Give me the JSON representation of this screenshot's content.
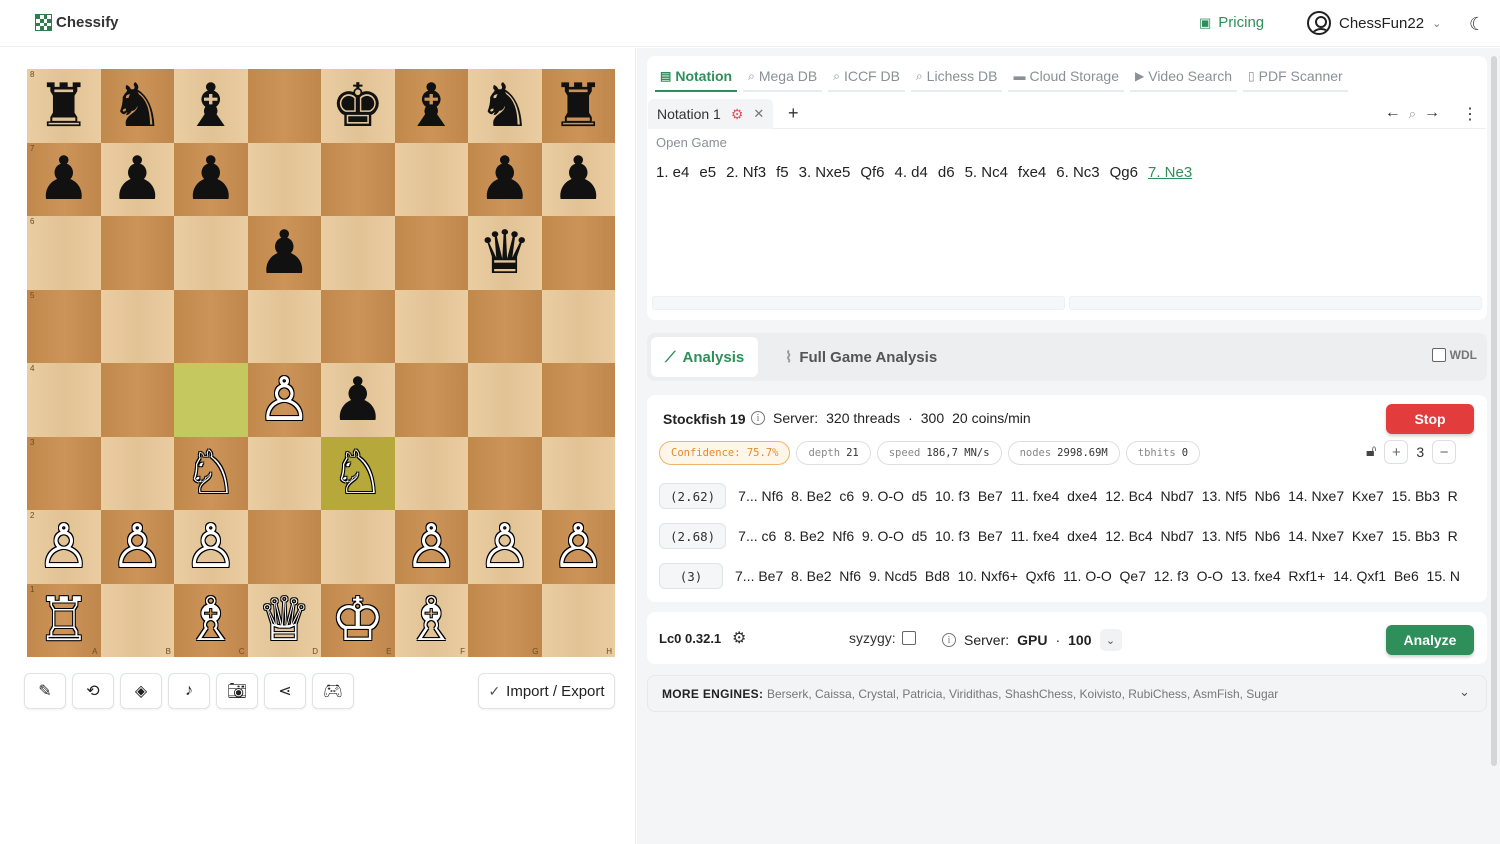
{
  "header": {
    "logo_text": "Chessify",
    "pricing_label": "Pricing",
    "username": "ChessFun22"
  },
  "board": {
    "ranks": [
      [
        "♜",
        "♞",
        "♝",
        "",
        "♚",
        "♝",
        "♞",
        "♜"
      ],
      [
        "♟",
        "♟",
        "♟",
        "",
        "",
        "",
        "♟",
        "♟"
      ],
      [
        "",
        "",
        "",
        "♟",
        "",
        "",
        "♛",
        ""
      ],
      [
        "",
        "",
        "",
        "",
        "",
        "",
        "",
        ""
      ],
      [
        "",
        "",
        "",
        "♙",
        "♟",
        "",
        "",
        ""
      ],
      [
        "",
        "",
        "♘",
        "",
        "♘",
        "",
        "",
        ""
      ],
      [
        "♙",
        "♙",
        "♙",
        "",
        "",
        "♙",
        "♙",
        "♙"
      ],
      [
        "♖",
        "",
        "♗",
        "♕",
        "♔",
        "♗",
        "",
        ""
      ]
    ],
    "rank_labels": [
      "8",
      "7",
      "6",
      "5",
      "4",
      "3",
      "2",
      "1"
    ],
    "file_labels": [
      "A",
      "B",
      "C",
      "D",
      "E",
      "F",
      "G",
      "H"
    ],
    "highlighted": [
      "c4",
      "e3"
    ]
  },
  "toolbar": {
    "tools": [
      "edit-icon",
      "flip-icon",
      "layers-icon",
      "music-icon",
      "camera-icon",
      "share-icon",
      "gamepad-icon"
    ],
    "import_export_label": "Import / Export"
  },
  "tabs": [
    {
      "label": "Notation",
      "icon": "notation-icon",
      "active": true
    },
    {
      "label": "Mega DB",
      "icon": "search-icon"
    },
    {
      "label": "ICCF DB",
      "icon": "search-icon"
    },
    {
      "label": "Lichess DB",
      "icon": "search-icon"
    },
    {
      "label": "Cloud Storage",
      "icon": "folder-icon"
    },
    {
      "label": "Video Search",
      "icon": "video-icon"
    },
    {
      "label": "PDF Scanner",
      "icon": "pdf-icon"
    }
  ],
  "notation": {
    "tab_label": "Notation 1",
    "opening_name": "Open Game",
    "moves": [
      "1. e4",
      "e5",
      "2. Nf3",
      "f5",
      "3. Nxe5",
      "Qf6",
      "4. d4",
      "d6",
      "5. Nc4",
      "fxe4",
      "6. Nc3",
      "Qg6",
      "7. Ne3"
    ]
  },
  "analysis": {
    "tab_analysis": "Analysis",
    "tab_full": "Full Game Analysis",
    "wdl_label": "WDL"
  },
  "engine": {
    "name": "Stockfish 19",
    "server_label": "Server:",
    "threads": "320 threads",
    "sep": "·",
    "coins_value": "300",
    "coins_rate": "20 coins/min",
    "stop_label": "Stop",
    "stats": {
      "confidence": "Confidence: 75.7%",
      "depth_label": "depth",
      "depth_value": "21",
      "speed_label": "speed",
      "speed_value": "186,7 MN/s",
      "nodes_label": "nodes",
      "nodes_value": "2998.69M",
      "tbhits_label": "tbhits",
      "tbhits_value": "0"
    },
    "lines_count": "3",
    "lines": [
      {
        "score": "(2.62)",
        "moves": "7... Nf6  8. Be2  c6  9. O-O  d5  10. f3  Be7  11. fxe4  dxe4  12. Bc4  Nbd7  13. Nf5  Nb6  14. Nxe7  Kxe7  15. Bb3  R"
      },
      {
        "score": "(2.68)",
        "moves": "7... c6  8. Be2  Nf6  9. O-O  d5  10. f3  Be7  11. fxe4  dxe4  12. Bc4  Nbd7  13. Nf5  Nb6  14. Nxe7  Kxe7  15. Bb3  R"
      },
      {
        "score": "(3)",
        "moves": "7... Be7  8. Be2  Nf6  9. Ncd5  Bd8  10. Nxf6+  Qxf6  11. O-O  Qe7  12. f3  O-O  13. fxe4  Rxf1+  14. Qxf1  Be6  15. N"
      }
    ]
  },
  "lc0": {
    "name": "Lc0 0.32.1",
    "syzygy_label": "syzygy:",
    "server_label": "Server:",
    "server_type": "GPU",
    "sep": "·",
    "server_value": "100",
    "analyze_label": "Analyze"
  },
  "more_engines": {
    "label": "MORE ENGINES:",
    "list": "Berserk, Caissa, Crystal, Patricia, Viridithas, ShashChess, Koivisto, RubiChess, AsmFish, Sugar"
  },
  "colors": {
    "accent": "#2f8f5b",
    "stop": "#e23c3c",
    "light_square": "#e8c99a",
    "dark_square": "#c98e4f"
  }
}
